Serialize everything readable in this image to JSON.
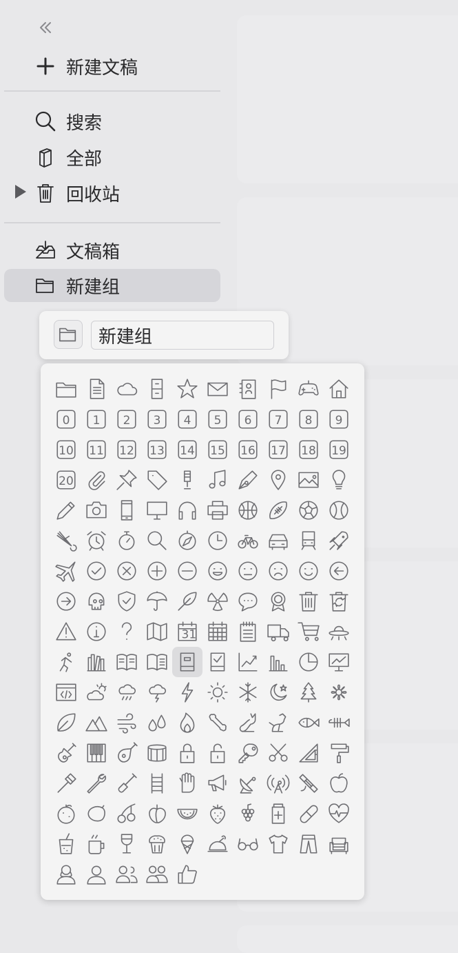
{
  "sidebar": {
    "new_doc": "新建文稿",
    "search": "搜索",
    "all": "全部",
    "trash": "回收站",
    "inbox": "文稿箱",
    "new_group": "新建组"
  },
  "rename": {
    "value": "新建组"
  },
  "icons": [
    "folder-icon",
    "document-icon",
    "cloud-icon",
    "cabinet-icon",
    "star-icon",
    "mail-icon",
    "contacts-icon",
    "flag-icon",
    "gamepad-icon",
    "house-icon",
    "0",
    "1",
    "2",
    "3",
    "4",
    "5",
    "6",
    "7",
    "8",
    "9",
    "10",
    "11",
    "12",
    "13",
    "14",
    "15",
    "16",
    "17",
    "18",
    "19",
    "20",
    "paperclip-icon",
    "pin-icon",
    "tag-icon",
    "microphone-icon",
    "music-note-icon",
    "pen-nib-icon",
    "map-pin-icon",
    "photo-icon",
    "lightbulb-icon",
    "pencil-icon",
    "camera-icon",
    "phone-icon",
    "monitor-icon",
    "headphones-icon",
    "printer-icon",
    "basketball-icon",
    "football-icon",
    "soccer-ball-icon",
    "tennis-ball-icon",
    "shuttlecock-icon",
    "alarm-clock-icon",
    "stopwatch-icon",
    "magnifier-icon",
    "compass-icon",
    "clock-icon",
    "bicycle-icon",
    "car-icon",
    "train-icon",
    "rocket-icon",
    "airplane-icon",
    "check-circle-icon",
    "x-circle-icon",
    "plus-circle-icon",
    "minus-circle-icon",
    "laugh-face-icon",
    "neutral-face-icon",
    "sad-face-icon",
    "smile-face-icon",
    "arrow-left-circle-icon",
    "arrow-right-circle-icon",
    "skull-icon",
    "shield-check-icon",
    "umbrella-icon",
    "feather-icon",
    "radiation-icon",
    "speech-bubble-icon",
    "award-icon",
    "trash-icon",
    "recycle-bin-icon",
    "warning-icon",
    "info-icon",
    "question-icon",
    "map-icon",
    "calendar-31-icon",
    "calendar-grid-icon",
    "notepad-icon",
    "truck-icon",
    "cart-icon",
    "ufo-icon",
    "runner-icon",
    "books-icon",
    "open-book-icon",
    "open-book-alt-icon",
    "archive-drawer-icon",
    "checklist-tray-icon",
    "line-chart-icon",
    "bar-chart-icon",
    "pie-chart-icon",
    "presentation-icon",
    "code-window-icon",
    "partly-cloudy-icon",
    "rain-cloud-icon",
    "storm-cloud-icon",
    "lightning-icon",
    "sun-icon",
    "snowflake-icon",
    "moon-star-icon",
    "pine-tree-icon",
    "flower-icon",
    "leaf-icon",
    "mountains-icon",
    "wind-icon",
    "water-drops-icon",
    "fire-icon",
    "bone-icon",
    "cat-icon",
    "dog-icon",
    "fish-icon",
    "fish-bone-icon",
    "guitar-icon",
    "piano-icon",
    "lute-icon",
    "drum-icon",
    "lock-icon",
    "unlock-icon",
    "key-icon",
    "scissors-icon",
    "set-square-icon",
    "paint-roller-icon",
    "axe-icon",
    "wrench-icon",
    "shovel-icon",
    "ladder-icon",
    "glove-icon",
    "megaphone-icon",
    "satellite-dish-icon",
    "antenna-icon",
    "satellite-icon",
    "apple-icon",
    "orange-icon",
    "lemon-icon",
    "cherries-icon",
    "peach-icon",
    "watermelon-icon",
    "strawberry-icon",
    "grapes-icon",
    "medicine-icon",
    "pill-icon",
    "heartbeat-icon",
    "drink-icon",
    "mug-icon",
    "wine-glass-icon",
    "muffin-icon",
    "ice-cream-icon",
    "roast-chicken-icon",
    "glasses-icon",
    "tshirt-icon",
    "pants-icon",
    "sofa-icon",
    "woman-icon",
    "man-icon",
    "couple-icon",
    "group-icon",
    "thumbs-up-icon"
  ],
  "selected_icon": "archive-drawer-icon"
}
